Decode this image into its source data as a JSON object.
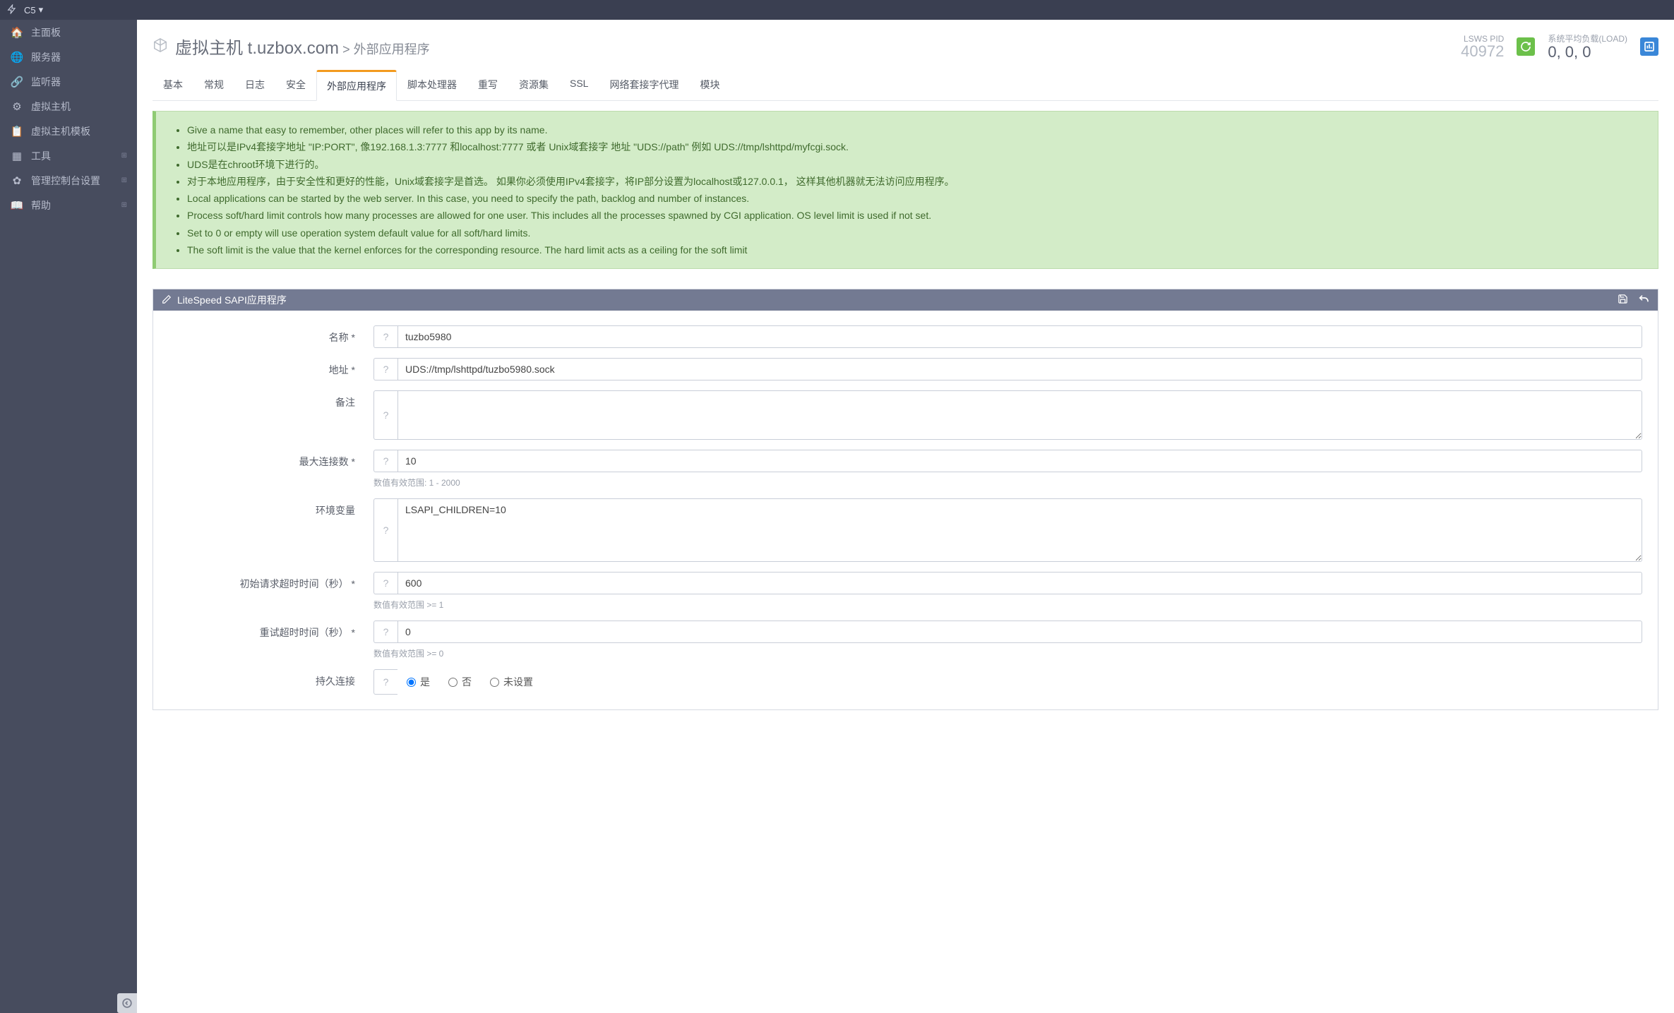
{
  "top": {
    "host_label": "C5"
  },
  "sidebar": {
    "items": [
      {
        "icon": "🏠",
        "label": "主面板"
      },
      {
        "icon": "🌐",
        "label": "服务器"
      },
      {
        "icon": "🔗",
        "label": "监听器"
      },
      {
        "icon": "⚙",
        "label": "虚拟主机"
      },
      {
        "icon": "📋",
        "label": "虚拟主机模板"
      },
      {
        "icon": "▦",
        "label": "工具",
        "expand": "⊞"
      },
      {
        "icon": "✿",
        "label": "管理控制台设置",
        "expand": "⊞"
      },
      {
        "icon": "📖",
        "label": "帮助",
        "expand": "⊞"
      }
    ]
  },
  "header": {
    "title": "虚拟主机 t.uzbox.com",
    "sub": " > 外部应用程序",
    "pid_label": "LSWS PID",
    "pid_value": "40972",
    "load_label": "系统平均负载(LOAD)",
    "load_value": "0, 0, 0"
  },
  "tabs": [
    "基本",
    "常规",
    "日志",
    "安全",
    "外部应用程序",
    "脚本处理器",
    "重写",
    "资源集",
    "SSL",
    "网络套接字代理",
    "模块"
  ],
  "active_tab_index": 4,
  "info": [
    "Give a name that easy to remember, other places will refer to this app by its name.",
    "地址可以是IPv4套接字地址 \"IP:PORT\", 像192.168.1.3:7777 和localhost:7777 或者 Unix域套接字 地址 \"UDS://path\" 例如 UDS://tmp/lshttpd/myfcgi.sock.",
    "UDS是在chroot环境下进行的。",
    "对于本地应用程序，由于安全性和更好的性能，Unix域套接字是首选。 如果你必须使用IPv4套接字，将IP部分设置为localhost或127.0.0.1， 这样其他机器就无法访问应用程序。",
    "Local applications can be started by the web server. In this case, you need to specify the path, backlog and number of instances.",
    "Process soft/hard limit controls how many processes are allowed for one user. This includes all the processes spawned by CGI application. OS level limit is used if not set.",
    "Set to 0 or empty will use operation system default value for all soft/hard limits.",
    "The soft limit is the value that the kernel enforces for the corresponding resource. The hard limit acts as a ceiling for the soft limit"
  ],
  "panel": {
    "title": "LiteSpeed SAPI应用程序"
  },
  "form": {
    "name_label": "名称 *",
    "name_value": "tuzbo5980",
    "addr_label": "地址 *",
    "addr_value": "UDS://tmp/lshttpd/tuzbo5980.sock",
    "note_label": "备注",
    "note_value": "",
    "maxconn_label": "最大连接数 *",
    "maxconn_value": "10",
    "maxconn_hint": "数值有效范围: 1 - 2000",
    "env_label": "环境变量",
    "env_value": "LSAPI_CHILDREN=10",
    "initto_label": "初始请求超时时间（秒） *",
    "initto_value": "600",
    "initto_hint": "数值有效范围 >= 1",
    "retryto_label": "重试超时时间（秒） *",
    "retryto_value": "0",
    "retryto_hint": "数值有效范围 >= 0",
    "keepalive_label": "持久连接",
    "radio_yes": "是",
    "radio_no": "否",
    "radio_unset": "未设置"
  }
}
